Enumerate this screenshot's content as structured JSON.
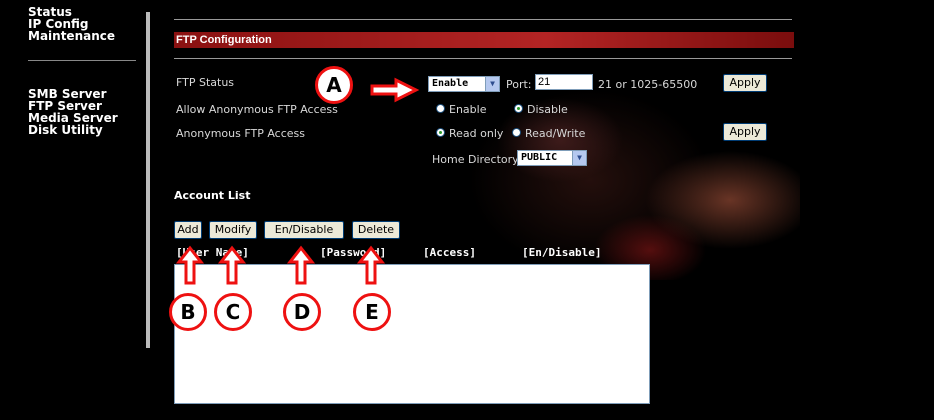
{
  "sidebar": {
    "group1": [
      "Status",
      "IP Config",
      "Maintenance"
    ],
    "group2": [
      "SMB Server",
      "FTP Server",
      "Media Server",
      "Disk Utility"
    ]
  },
  "section": {
    "title": "FTP Configuration"
  },
  "ftp": {
    "status_label": "FTP Status",
    "status_value": "Enable",
    "port_label": "Port:",
    "port_value": "21",
    "port_hint": "21 or 1025-65500",
    "apply_label": "Apply",
    "allow_anon_label": "Allow Anonymous FTP Access",
    "enable_label": "Enable",
    "disable_label": "Disable",
    "anon_access_label": "Anonymous FTP Access",
    "read_only_label": "Read only",
    "read_write_label": "Read/Write",
    "apply2_label": "Apply",
    "home_dir_label": "Home Directory:",
    "home_dir_value": "PUBLIC"
  },
  "account": {
    "title": "Account List",
    "buttons": {
      "add": "Add",
      "modify": "Modify",
      "endisable": "En/Disable",
      "delete": "Delete"
    },
    "columns": [
      "[User Name]",
      "[Password]",
      "[Access]",
      "[En/Disable]"
    ]
  },
  "callouts": {
    "a": "A",
    "b": "B",
    "c": "C",
    "d": "D",
    "e": "E"
  },
  "colors": {
    "callout_red": "#ee1111",
    "header_red": "#b32424"
  }
}
